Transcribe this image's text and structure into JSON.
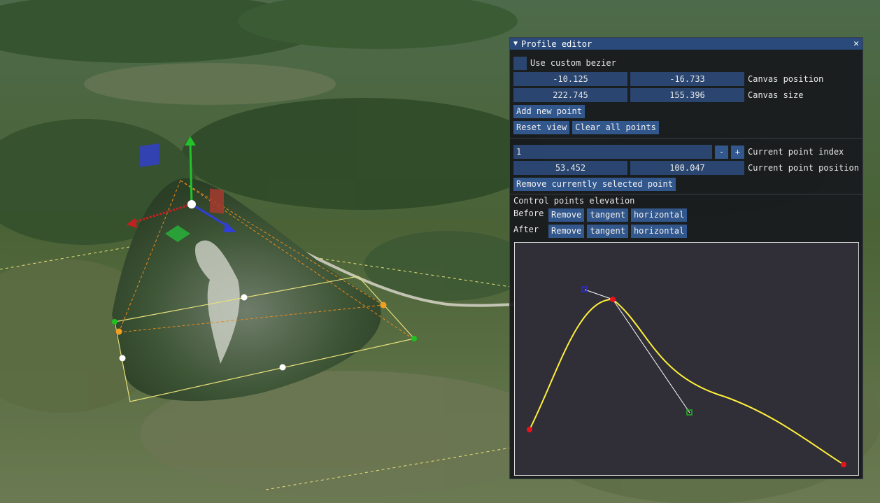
{
  "window": {
    "title": "Profile editor",
    "collapse_icon": "triangle-down-icon",
    "close_icon": "close-icon"
  },
  "custom_bezier": {
    "label": "Use custom bezier",
    "checked": false
  },
  "canvas_position": {
    "x": "-10.125",
    "y": "-16.733",
    "label": "Canvas position"
  },
  "canvas_size": {
    "w": "222.745",
    "h": "155.396",
    "label": "Canvas size"
  },
  "buttons": {
    "add_point": "Add new point",
    "reset_view": "Reset view",
    "clear_points": "Clear all points",
    "remove_selected": "Remove currently selected point"
  },
  "current_point": {
    "index": "1",
    "index_label": "Current point index",
    "minus": "-",
    "plus": "+",
    "x": "53.452",
    "y": "100.047",
    "position_label": "Current point position"
  },
  "elevation": {
    "title": "Control points elevation",
    "before_label": "Before",
    "after_label": "After",
    "remove": "Remove",
    "tangent": "tangent",
    "horizontal": "horizontal"
  },
  "colors": {
    "curve": "#ffef3a",
    "point": "#e8141c",
    "handle_before": "#2b2bd0",
    "handle_after": "#1db31d",
    "handle_line": "#ffffff"
  }
}
